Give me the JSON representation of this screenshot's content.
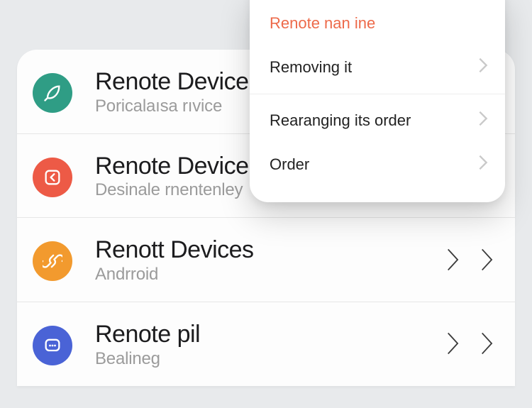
{
  "colors": {
    "teal": "#2f9d85",
    "red": "#ed5a46",
    "orange": "#f29a2e",
    "blue": "#4a63d6",
    "accent": "#ed6a4a"
  },
  "devices": [
    {
      "title": "Renote Device",
      "subtitle": "Poricalaısa rıvice",
      "icon": "leaf-icon",
      "color": "teal",
      "chevrons": 0
    },
    {
      "title": "Renote Device",
      "subtitle": "Desinale rnentenley",
      "icon": "back-square-icon",
      "color": "red",
      "chevrons": 1
    },
    {
      "title": "Renott Devices",
      "subtitle": "Andrroid",
      "icon": "link-icon",
      "color": "orange",
      "chevrons": 2
    },
    {
      "title": "Renote pil",
      "subtitle": "Bealineg",
      "icon": "chat-square-icon",
      "color": "blue",
      "chevrons": 2
    }
  ],
  "popover": {
    "header": "Renote nan ine",
    "items": [
      {
        "label": "Removing it",
        "divider": true
      },
      {
        "label": "Rearanging its order",
        "divider": false
      },
      {
        "label": "Order",
        "divider": false
      }
    ]
  }
}
